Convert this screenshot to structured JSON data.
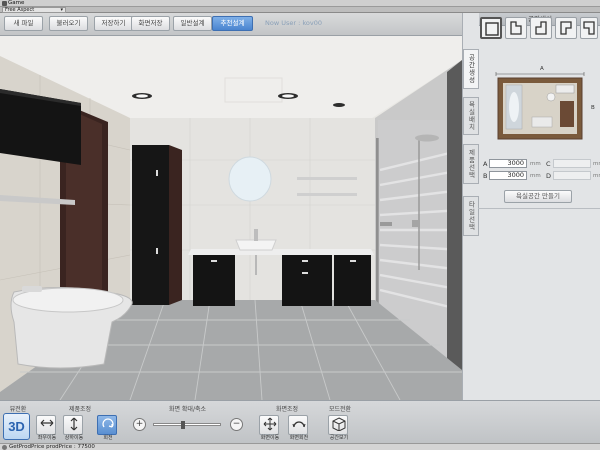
{
  "window": {
    "title": "Game",
    "aspect_option": "Free Aspect"
  },
  "toolbar": {
    "buttons": [
      "새 파일",
      "불러오기",
      "저장하기",
      "화면저장",
      "일반설계",
      "추천설계"
    ],
    "active_index": 5,
    "user_label": "Now User : kov00"
  },
  "right_panel": {
    "header": "공간생성",
    "tabs": [
      "공간생성",
      "욕실배치",
      "제품선택",
      "타일선택"
    ],
    "active_tab": 0,
    "shapes": [
      "rect",
      "l-shape-1",
      "l-shape-2",
      "l-shape-3",
      "l-shape-4"
    ],
    "dim_labels": {
      "top": "A",
      "right": "B"
    },
    "fields": [
      {
        "label": "A",
        "value": "3000",
        "unit": "mm",
        "enabled": true
      },
      {
        "label": "C",
        "value": "",
        "unit": "mm",
        "enabled": false
      },
      {
        "label": "B",
        "value": "3000",
        "unit": "mm",
        "enabled": true
      },
      {
        "label": "D",
        "value": "",
        "unit": "mm",
        "enabled": false
      }
    ],
    "make_button": "욕실공간 만들기"
  },
  "bottom": {
    "groups": {
      "view": "뷰전환",
      "product": "제품조정",
      "zoom": "화면 확대/축소",
      "screen": "화면조정",
      "mode": "모드전환"
    },
    "btn_3d": "3D",
    "buttons": {
      "move_lr": "좌우이동",
      "move_ud": "상하이동",
      "rotate": "회전",
      "screen_move": "화면이동",
      "screen_rotate": "화면회전",
      "space_view": "공간보기"
    },
    "zoom_in": "+",
    "zoom_out": "−",
    "zoom_level": 0.42
  },
  "status": {
    "text": "GetProdPrice prodPrice : 77500"
  },
  "colors": {
    "accent": "#4a84cf",
    "cabinet": "#1a1a1a",
    "wood": "#3a2420",
    "floor": "#a7a9aa"
  }
}
